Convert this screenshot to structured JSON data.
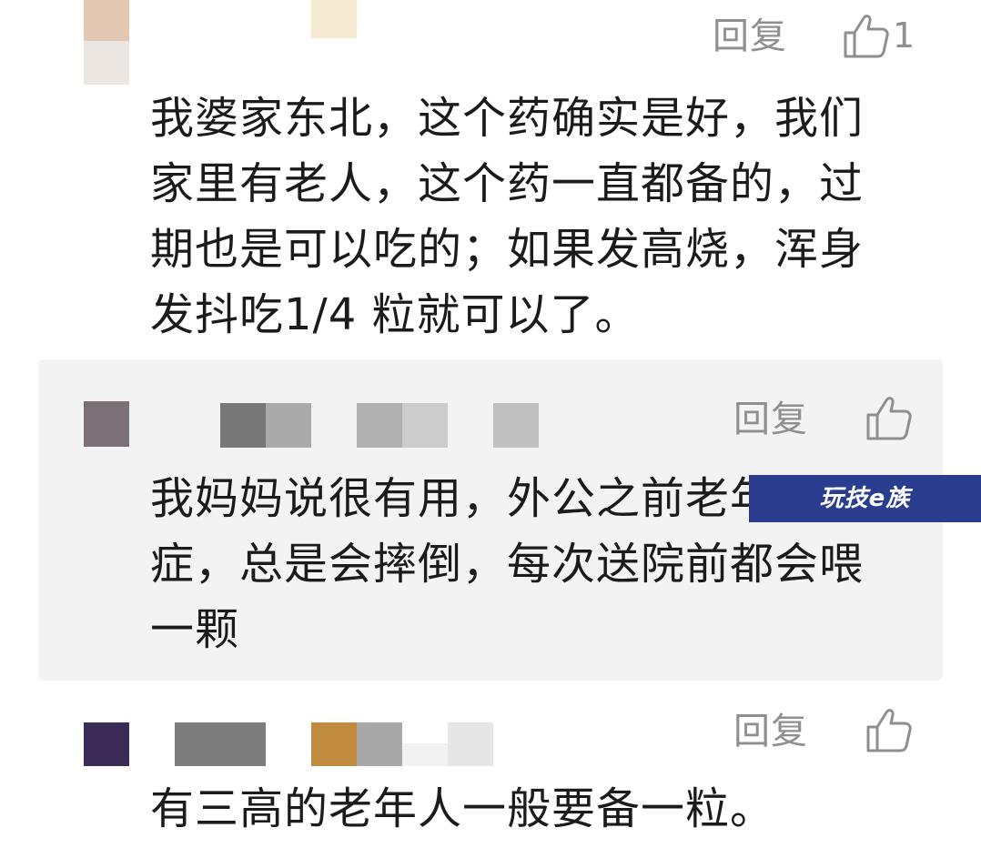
{
  "comments": [
    {
      "reply_label": "回复",
      "like_count": "1",
      "text": "我婆家东北，这个药确实是好，我们\n家里有老人，这个药一直都备的，过\n期也是可以吃的；如果发高烧，浑身\n发抖吃1/4 粒就可以了。"
    },
    {
      "reply_label": "回复",
      "like_count": "",
      "text": "我妈妈说很有用，外公之前老年\n症，总是会摔倒，每次送院前都会喂\n一颗"
    },
    {
      "reply_label": "回复",
      "like_count": "",
      "text": "有三高的老年人一般要备一粒。"
    }
  ],
  "watermark": {
    "text": "玩技e族"
  },
  "colors": {
    "reply_panel_bg": "#f3f3f3",
    "secondary_text": "#8f8f8f",
    "primary_text": "#1b1b1b",
    "watermark_bg": "#2b3d8e"
  },
  "icons": {
    "like": "thumbs-up-icon",
    "avatar": "pixelated-avatar-icon",
    "username": "pixelated-username"
  }
}
